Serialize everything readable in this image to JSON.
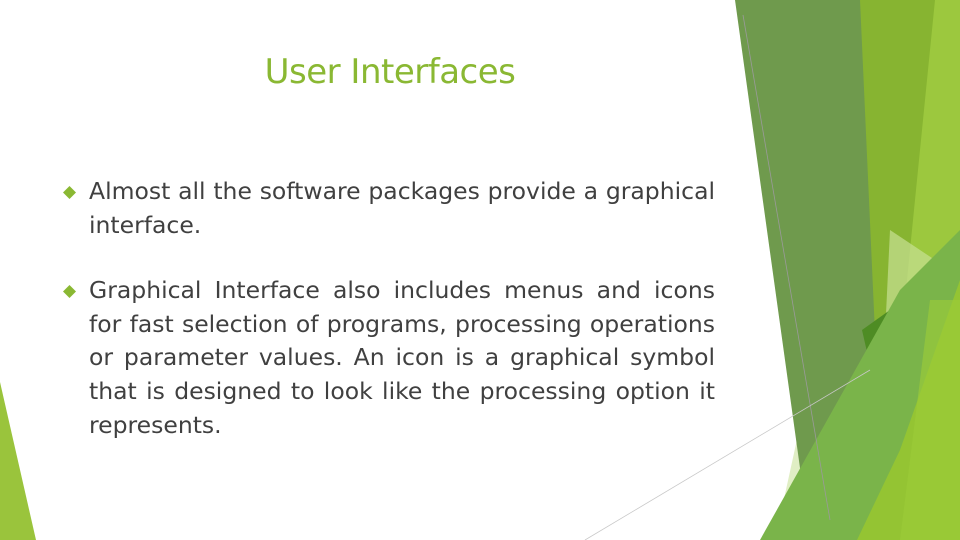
{
  "slide": {
    "title": "User Interfaces",
    "bullets": [
      {
        "icon": "diamond-bullet-icon",
        "text": "Almost all the software packages provide a graphical interface."
      },
      {
        "icon": "diamond-bullet-icon",
        "text": "Graphical Interface also includes menus and icons for fast selection of programs, processing operations or parameter values. An icon is a graphical symbol that is designed to look like the processing option it represents."
      }
    ]
  },
  "theme": {
    "accent": "#8ab833",
    "text_color": "#404040",
    "bullet_color": "#8ab833"
  }
}
